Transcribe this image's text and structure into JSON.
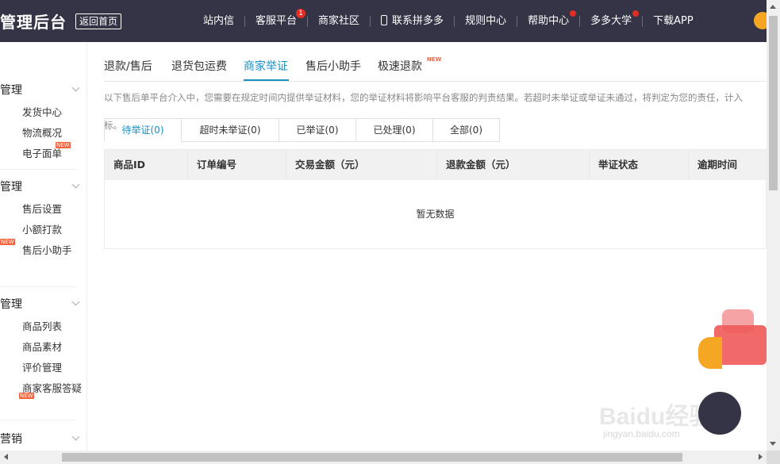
{
  "header": {
    "brand": "管理后台",
    "back_home": "返回首页",
    "nav": [
      {
        "label": "站内信"
      },
      {
        "label": "客服平台",
        "badge": "1"
      },
      {
        "label": "商家社区"
      },
      {
        "label": "联系拼多多",
        "icon": "phone-icon"
      },
      {
        "label": "规则中心"
      },
      {
        "label": "帮助中心",
        "dot": true
      },
      {
        "label": "多多大学",
        "dot": true
      },
      {
        "label": "下载APP"
      }
    ]
  },
  "sidebar": {
    "groups": [
      {
        "title": "管理",
        "items": [
          "发货中心",
          "物流概况",
          "电子面单"
        ]
      },
      {
        "title": "管理",
        "items": [
          "售后设置",
          "小额打款",
          "售后小助手"
        ]
      },
      {
        "title": "管理",
        "items": [
          "商品列表",
          "商品素材",
          "评价管理",
          "商家客服答疑"
        ]
      },
      {
        "title": "营销",
        "items": []
      }
    ],
    "new_label": "NEW"
  },
  "main": {
    "tabs": [
      "退款/售后",
      "退货包运费",
      "商家举证",
      "售后小助手",
      "极速退款"
    ],
    "tab_new_label": "NEW",
    "notice": "以下售后单平台介入中，您需要在规定时间内提供举证材料，您的举证材料将影响平台客服的判责结果。若超时未举证或举证未通过，将判定为您的责任，计入",
    "notice_tail": "标。",
    "subtabs": [
      "待举证(0)",
      "超时未举证(0)",
      "已举证(0)",
      "已处理(0)",
      "全部(0)"
    ],
    "columns": [
      "商品ID",
      "订单编号",
      "交易金额（元）",
      "退款金额（元）",
      "举证状态",
      "逾期时间"
    ],
    "empty_text": "暂无数据"
  },
  "watermark": {
    "text": "Baidu经验",
    "url_text": "jingyan.baidu.com"
  },
  "colors": {
    "topbar": "#353446",
    "accent": "#1890c6",
    "badge": "#e02e24"
  }
}
